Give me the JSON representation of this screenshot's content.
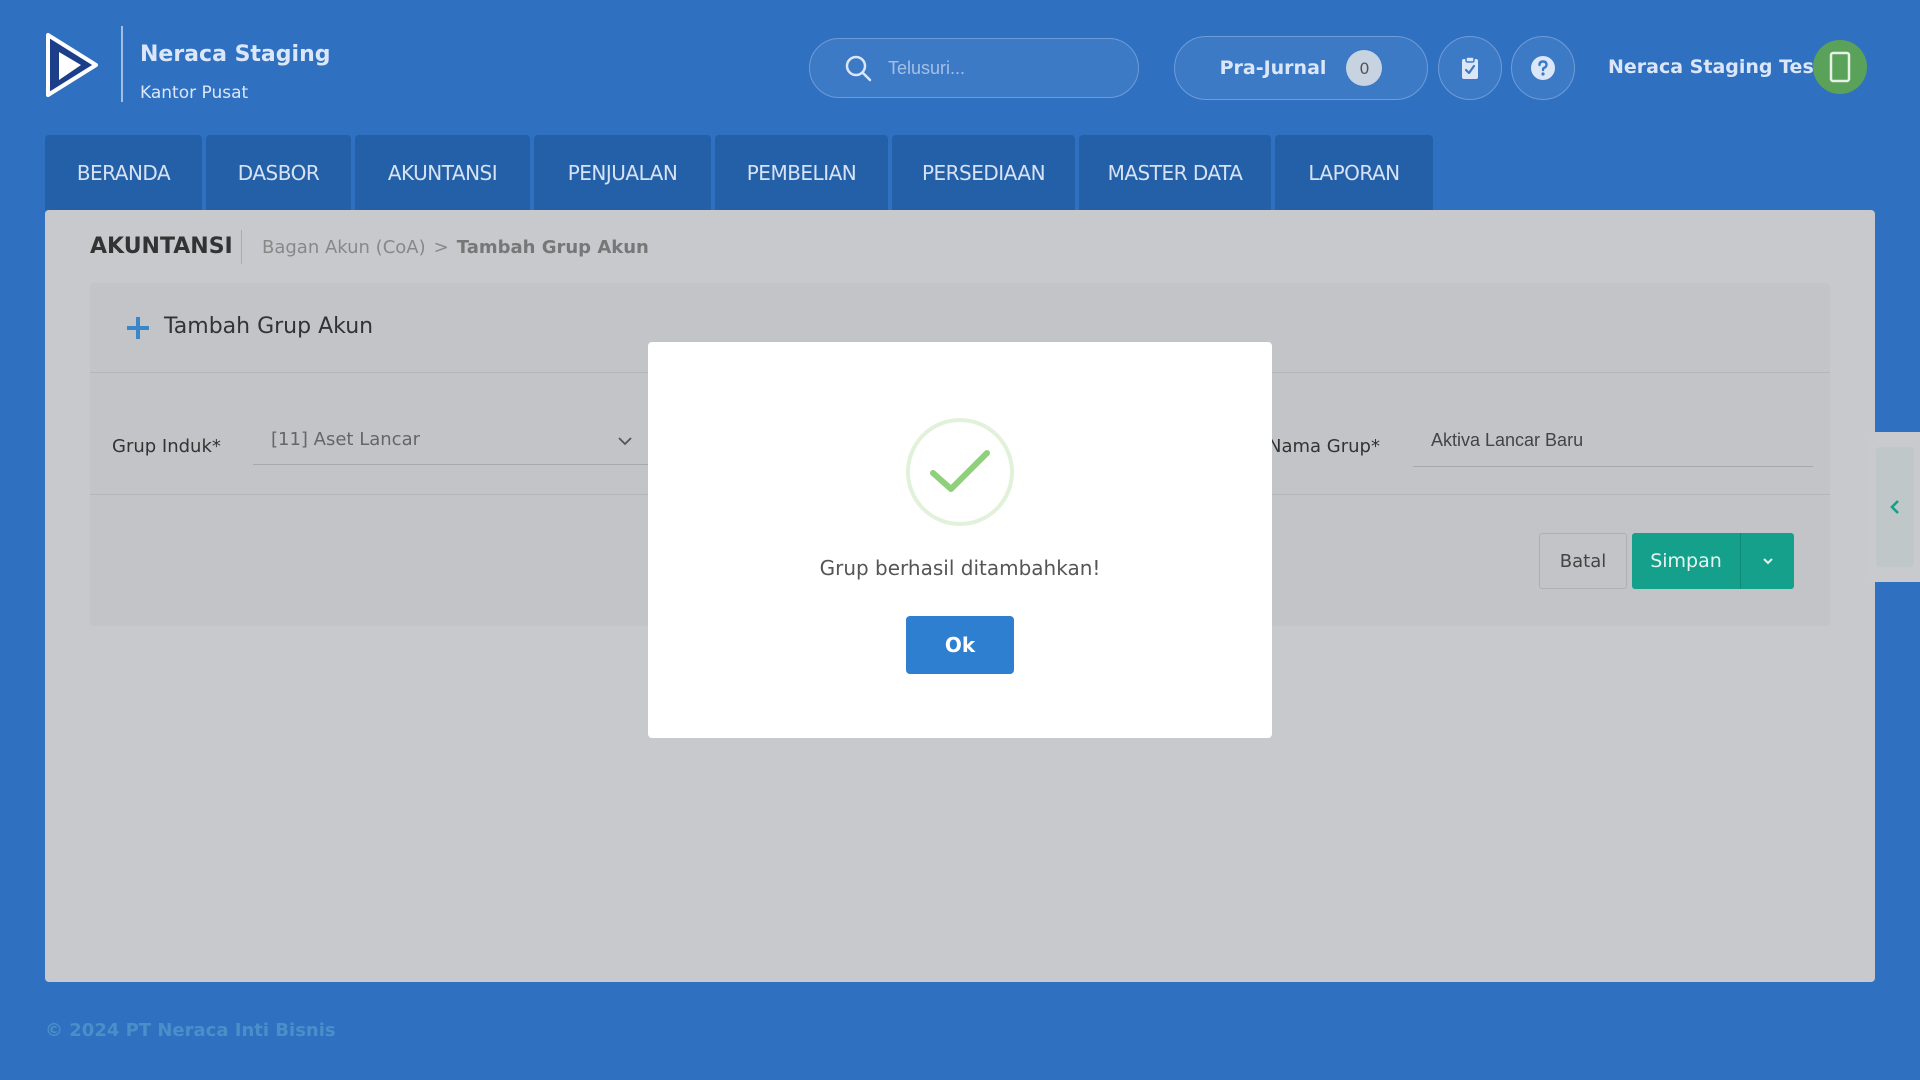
{
  "header": {
    "brand_title": "Neraca Staging",
    "brand_subtitle": "Kantor Pusat",
    "search_placeholder": "Telusuri...",
    "prajurnal_label": "Pra-Jurnal",
    "prajurnal_count": "0",
    "user_name": "Neraca Staging Test"
  },
  "nav": {
    "tabs": [
      "BERANDA",
      "DASBOR",
      "AKUNTANSI",
      "PENJUALAN",
      "PEMBELIAN",
      "PERSEDIAAN",
      "MASTER DATA",
      "LAPORAN"
    ]
  },
  "main": {
    "section_title": "AKUNTANSI",
    "breadcrumb_parent": "Bagan Akun (CoA)",
    "breadcrumb_sep": ">",
    "breadcrumb_current": "Tambah Grup Akun",
    "card_title": "Tambah Grup Akun",
    "grup_induk_label": "Grup Induk*",
    "grup_induk_value": "[11] Aset Lancar",
    "nama_grup_label": "Nama Grup*",
    "nama_grup_value": "Aktiva Lancar Baru",
    "batal_label": "Batal",
    "simpan_label": "Simpan"
  },
  "modal": {
    "message": "Grup berhasil ditambahkan!",
    "ok_label": "Ok"
  },
  "footer": {
    "copyright": "© 2024 PT Neraca Inti Bisnis"
  },
  "colors": {
    "background": "#2f70c0",
    "primary_button": "#2f7fd0",
    "save_button": "#15a08b",
    "success_check": "#8fd07a"
  }
}
